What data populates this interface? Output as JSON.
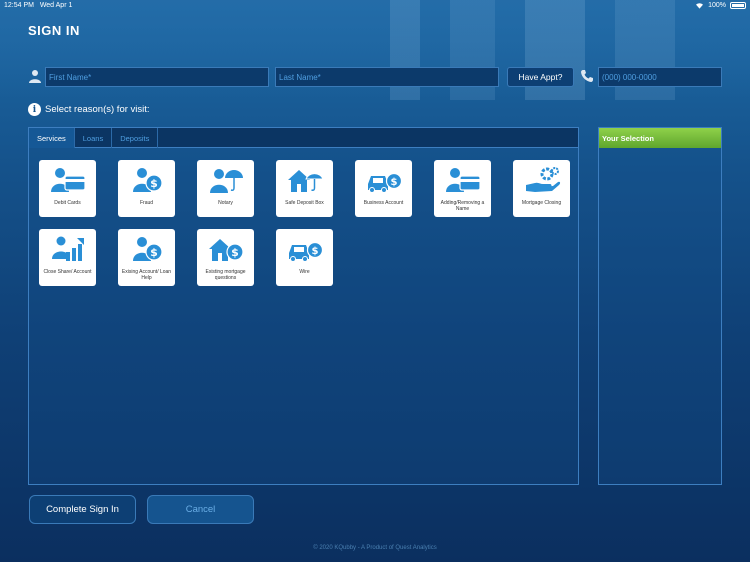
{
  "status_bar": {
    "time": "12:54 PM",
    "date": "Wed Apr 1",
    "battery": "100%"
  },
  "title": "SIGN IN",
  "form": {
    "first_name_placeholder": "First Name*",
    "last_name_placeholder": "Last Name*",
    "appt_button": "Have Appt?",
    "phone_placeholder": "(000) 000-0000"
  },
  "reason_label": "Select reason(s) for visit:",
  "tabs": [
    {
      "label": "Services",
      "active": true
    },
    {
      "label": "Loans",
      "active": false
    },
    {
      "label": "Deposits",
      "active": false
    }
  ],
  "tiles": [
    {
      "label": "Debit Cards",
      "icon": "debit-card-icon"
    },
    {
      "label": "Fraud",
      "icon": "fraud-icon"
    },
    {
      "label": "Notary",
      "icon": "notary-icon"
    },
    {
      "label": "Safe Deposit Box",
      "icon": "safe-deposit-icon"
    },
    {
      "label": "Business Account",
      "icon": "business-account-icon"
    },
    {
      "label": "Adding/Removing a Name",
      "icon": "add-remove-name-icon"
    },
    {
      "label": "Mortgage Closing",
      "icon": "mortgage-closing-icon"
    },
    {
      "label": "Close Share/ Account",
      "icon": "close-account-icon"
    },
    {
      "label": "Exising Account/ Loan Help",
      "icon": "existing-account-icon"
    },
    {
      "label": "Existing mortgage questions",
      "icon": "mortgage-questions-icon"
    },
    {
      "label": "Wire",
      "icon": "wire-icon"
    }
  ],
  "selection_title": "Your Selection",
  "buttons": {
    "complete": "Complete Sign In",
    "cancel": "Cancel"
  },
  "footer": "© 2020 KQubby - A Product of Quest Analytics",
  "colors": {
    "icon_blue": "#2a8fd6",
    "selection_green": "#7cc242",
    "background": "#15528b"
  }
}
